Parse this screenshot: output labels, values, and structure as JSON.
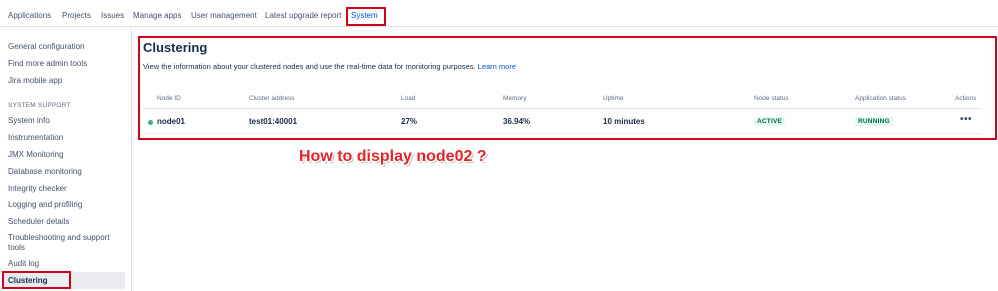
{
  "topnav": {
    "tabs": [
      {
        "label": "Applications"
      },
      {
        "label": "Projects"
      },
      {
        "label": "Issues"
      },
      {
        "label": "Manage apps"
      },
      {
        "label": "User management"
      },
      {
        "label": "Latest upgrade report"
      },
      {
        "label": "System",
        "active": true
      }
    ]
  },
  "sidebar": {
    "top_items": [
      "General configuration",
      "Find more admin tools",
      "Jira mobile app"
    ],
    "section_heading": "SYSTEM SUPPORT",
    "items": [
      "System info",
      "Instrumentation",
      "JMX Monitoring",
      "Database monitoring",
      "Integrity checker",
      "Logging and profiling",
      "Scheduler details",
      "Troubleshooting and support tools",
      "Audit log",
      "Clustering"
    ],
    "active_item": "Clustering"
  },
  "main": {
    "title": "Clustering",
    "description": "View the information about your clustered nodes and use the real-time data for monitoring purposes.",
    "learn_more": "Learn more",
    "table": {
      "headers": [
        "Node ID",
        "Cluster address",
        "Load",
        "Memory",
        "Uptime",
        "Node status",
        "Application status",
        "Actions"
      ],
      "rows": [
        {
          "node_id": "node01",
          "cluster_address": "test01:40001",
          "load": "27%",
          "memory": "36.94%",
          "uptime": "10 minutes",
          "node_status": "ACTIVE",
          "application_status": "RUNNING",
          "actions": "•••"
        }
      ]
    }
  },
  "annotation": "How to display node02 ?",
  "colors": {
    "accent": "#0052cc",
    "annotation_red": "#d0011b",
    "status_green": "#36b37e",
    "lozenge_bg": "#e3fcef",
    "lozenge_text": "#006644"
  }
}
